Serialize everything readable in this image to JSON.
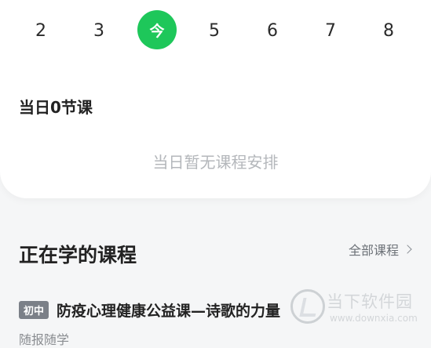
{
  "week": {
    "days": [
      {
        "label": "2"
      },
      {
        "label": "3"
      },
      {
        "label": "今",
        "selected": true
      },
      {
        "label": "5"
      },
      {
        "label": "6"
      },
      {
        "label": "7"
      },
      {
        "label": "8"
      }
    ],
    "accent": "#1ec75a"
  },
  "schedule": {
    "count_title": "当日0节课",
    "empty_text": "当日暂无课程安排"
  },
  "learning": {
    "title": "正在学的课程",
    "all_link": "全部课程",
    "courses": [
      {
        "badge": "初中",
        "title": "防疫心理健康公益课—诗歌的力量",
        "subtitle": "随报随学"
      }
    ]
  },
  "watermark": {
    "name": "当下软件园",
    "url": "www.downxia.com"
  }
}
